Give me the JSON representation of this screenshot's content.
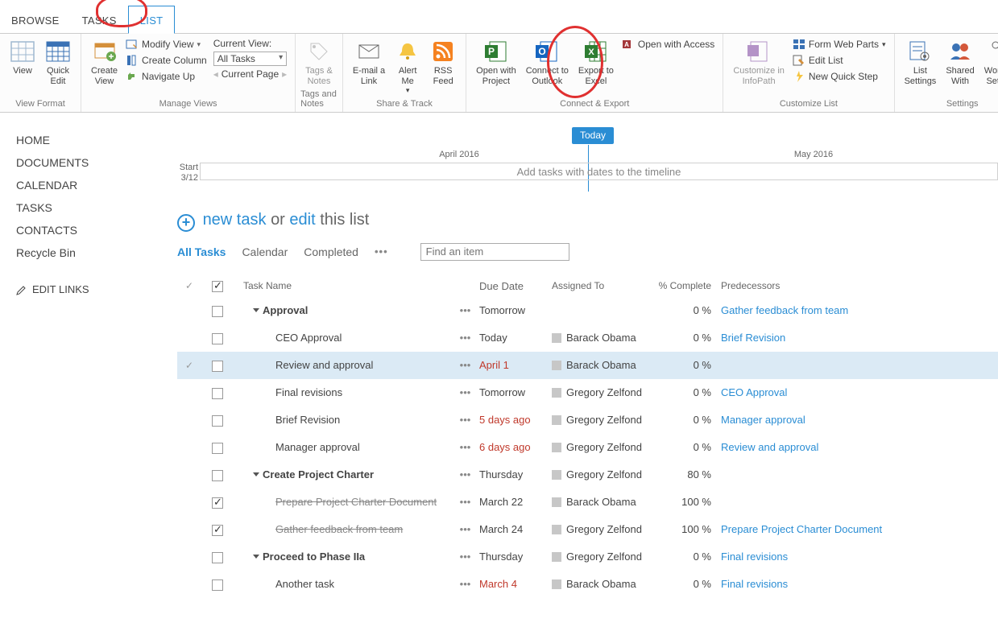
{
  "tabs": {
    "browse": "BROWSE",
    "tasks": "TASKS",
    "list": "LIST"
  },
  "ribbon": {
    "viewFormat": {
      "title": "View Format",
      "view": "View",
      "quickEdit": "Quick\nEdit"
    },
    "manageViews": {
      "title": "Manage Views",
      "createView": "Create\nView",
      "modifyView": "Modify View",
      "createColumn": "Create Column",
      "navigateUp": "Navigate Up",
      "currentViewLabel": "Current View:",
      "currentView": "All Tasks",
      "currentPage": "Current Page"
    },
    "tagsNotes": {
      "title": "Tags and Notes",
      "tags": "Tags &\nNotes"
    },
    "shareTrack": {
      "title": "Share & Track",
      "email": "E-mail a\nLink",
      "alert": "Alert\nMe",
      "rss": "RSS\nFeed"
    },
    "connectExport": {
      "title": "Connect & Export",
      "project": "Open with\nProject",
      "outlook": "Connect to\nOutlook",
      "excel": "Export to\nExcel",
      "access": "Open with Access"
    },
    "customize": {
      "title": "Customize List",
      "infopath": "Customize in\nInfoPath",
      "formWebParts": "Form Web Parts",
      "editList": "Edit List",
      "quickStep": "New Quick Step"
    },
    "settings": {
      "title": "Settings",
      "listSettings": "List\nSettings",
      "sharedWith": "Shared\nWith",
      "workflow": "Workflow\nSettings"
    }
  },
  "sidebar": {
    "items": [
      "HOME",
      "DOCUMENTS",
      "CALENDAR",
      "TASKS",
      "CONTACTS",
      "Recycle Bin"
    ],
    "editLinks": "EDIT LINKS"
  },
  "timeline": {
    "today": "Today",
    "month1": "April 2016",
    "month2": "May 2016",
    "startLabel": "Start",
    "startDate": "3/12",
    "placeholder": "Add tasks with dates to the timeline"
  },
  "newTask": {
    "new": "new task",
    "or": "or",
    "edit": "edit",
    "rest": "this list"
  },
  "views": {
    "all": "All Tasks",
    "calendar": "Calendar",
    "completed": "Completed"
  },
  "search": {
    "placeholder": "Find an item"
  },
  "columns": {
    "name": "Task Name",
    "due": "Due Date",
    "assigned": "Assigned To",
    "pct": "% Complete",
    "pred": "Predecessors"
  },
  "rows": [
    {
      "indent": 1,
      "caret": true,
      "bold": true,
      "name": "Approval",
      "due": "Tomorrow",
      "pct": "0 %",
      "pred": "Gather feedback from team"
    },
    {
      "indent": 2,
      "name": "CEO Approval",
      "due": "Today",
      "assigned": "Barack Obama",
      "pct": "0 %",
      "pred": "Brief Revision"
    },
    {
      "indent": 2,
      "name": "Review and approval",
      "due": "April 1",
      "overdue": true,
      "assigned": "Barack Obama",
      "pct": "0 %",
      "selected": true,
      "check1": true
    },
    {
      "indent": 2,
      "name": "Final revisions",
      "due": "Tomorrow",
      "assigned": "Gregory Zelfond",
      "pct": "0 %",
      "pred": "CEO Approval"
    },
    {
      "indent": 2,
      "name": "Brief Revision",
      "due": "5 days ago",
      "overdue": true,
      "assigned": "Gregory Zelfond",
      "pct": "0 %",
      "pred": "Manager approval"
    },
    {
      "indent": 2,
      "name": "Manager approval",
      "due": "6 days ago",
      "overdue": true,
      "assigned": "Gregory Zelfond",
      "pct": "0 %",
      "pred": "Review and approval"
    },
    {
      "indent": 1,
      "caret": true,
      "bold": true,
      "name": "Create Project Charter",
      "due": "Thursday",
      "assigned": "Gregory Zelfond",
      "pct": "80 %"
    },
    {
      "indent": 2,
      "checked": true,
      "strike": true,
      "name": "Prepare Project Charter Document",
      "due": "March 22",
      "assigned": "Barack Obama",
      "pct": "100 %"
    },
    {
      "indent": 2,
      "checked": true,
      "strike": true,
      "name": "Gather feedback from team",
      "due": "March 24",
      "assigned": "Gregory Zelfond",
      "pct": "100 %",
      "pred": "Prepare Project Charter Document"
    },
    {
      "indent": 1,
      "caret": true,
      "bold": true,
      "name": "Proceed to Phase IIa",
      "due": "Thursday",
      "assigned": "Gregory Zelfond",
      "pct": "0 %",
      "pred": "Final revisions"
    },
    {
      "indent": 2,
      "name": "Another task",
      "due": "March 4",
      "overdue": true,
      "assigned": "Barack Obama",
      "pct": "0 %",
      "pred": "Final revisions"
    }
  ]
}
